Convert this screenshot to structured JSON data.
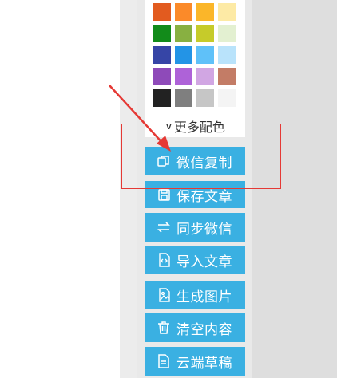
{
  "palette": {
    "colors": [
      [
        "#e25b1f",
        "#fb8a29",
        "#fbb629",
        "#fdeaa5"
      ],
      [
        "#128b1a",
        "#88b041",
        "#c6cb2a",
        "#e3f0d1"
      ],
      [
        "#3645a6",
        "#2394e6",
        "#5fc1f9",
        "#b9e3fb"
      ],
      [
        "#8e4ab9",
        "#ae62d8",
        "#d1a6e3",
        "#c37c66"
      ],
      [
        "#222222",
        "#7f7f7f",
        "#c6c6c6",
        "#f4f4f4"
      ]
    ],
    "more_label": "更多配色"
  },
  "toolbar": {
    "buttons": [
      {
        "name": "wechat-copy-button",
        "icon": "copy-icon",
        "label": "微信复制"
      },
      {
        "name": "save-article-button",
        "icon": "save-icon",
        "label": "保存文章"
      },
      {
        "name": "sync-wechat-button",
        "icon": "sync-icon",
        "label": "同步微信"
      },
      {
        "name": "import-article-button",
        "icon": "import-icon",
        "label": "导入文章"
      },
      {
        "name": "generate-image-button",
        "icon": "image-icon",
        "label": "生成图片"
      },
      {
        "name": "clear-content-button",
        "icon": "trash-icon",
        "label": "清空内容"
      },
      {
        "name": "cloud-draft-button",
        "icon": "document-icon",
        "label": "云端草稿"
      }
    ],
    "color": "#3ab0e2"
  },
  "annotation": {
    "color": "#e53935"
  }
}
